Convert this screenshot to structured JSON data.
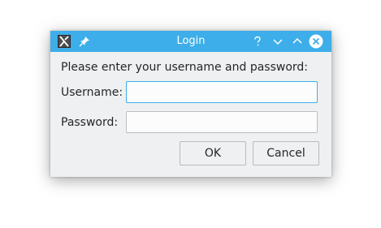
{
  "window": {
    "title": "Login",
    "accent_color": "#3daee9",
    "background_color": "#eff0f1",
    "titlebar_icons": [
      "app-icon",
      "pin-icon",
      "help-icon",
      "minimize-icon",
      "maximize-icon",
      "close-icon"
    ]
  },
  "form": {
    "prompt": "Please enter your username and password:",
    "username_label": "Username:",
    "username_value": "",
    "password_label": "Password:",
    "password_value": ""
  },
  "buttons": {
    "ok_label": "OK",
    "cancel_label": "Cancel"
  }
}
